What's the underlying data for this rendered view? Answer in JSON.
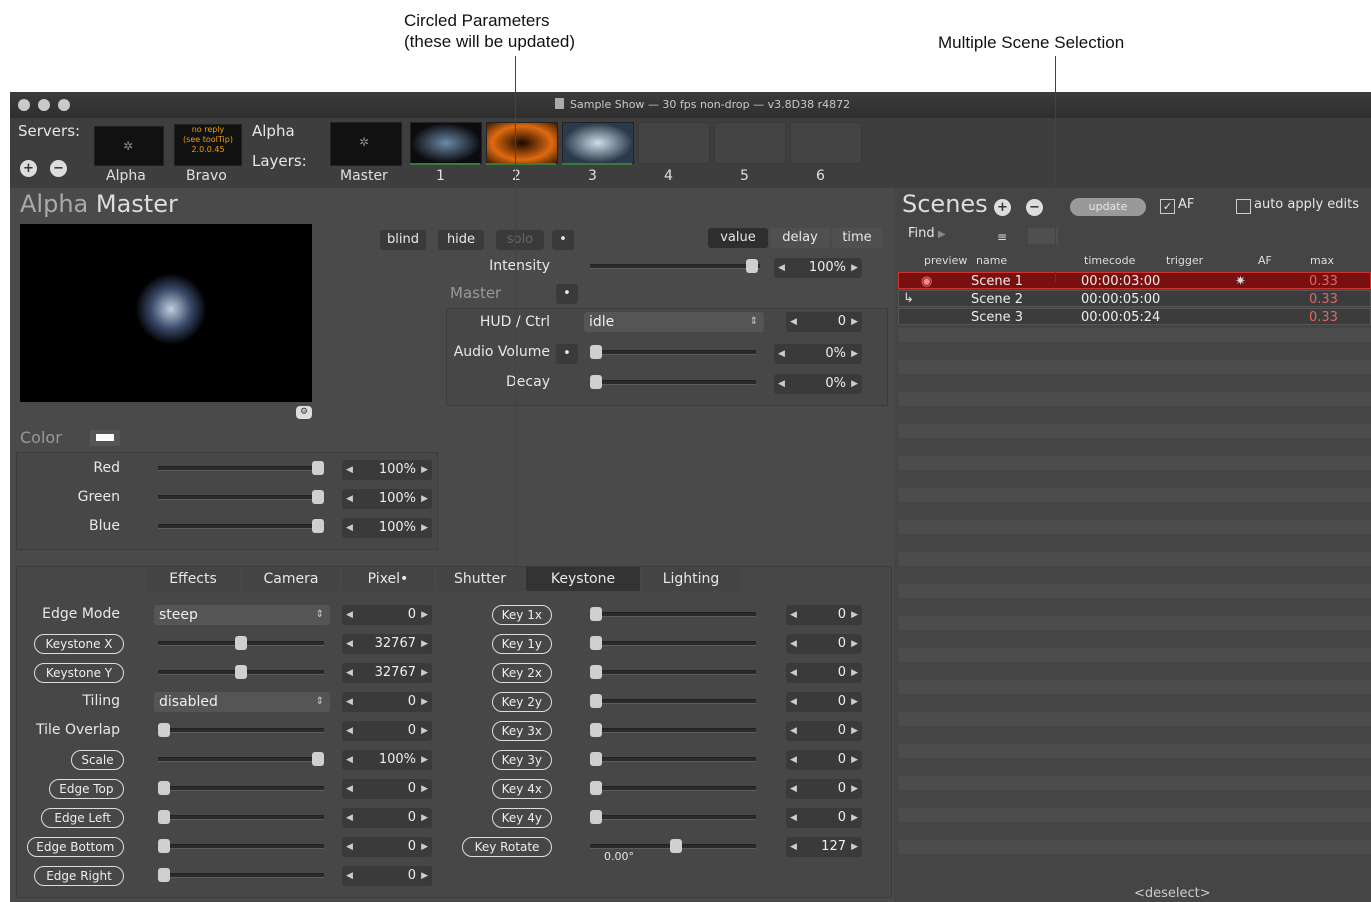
{
  "annotations": {
    "circled_line1": "Circled Parameters",
    "circled_line2": "(these will be updated)",
    "multi_scene": "Multiple Scene Selection"
  },
  "window": {
    "title": "Sample Show  —  30 fps non-drop  —  v3.8D38 r4872"
  },
  "servers": {
    "label": "Servers:",
    "items": [
      "Alpha",
      "Bravo"
    ],
    "bravo_status_line1": "no reply",
    "bravo_status_line2": "(see toolTip)",
    "bravo_status_line3": "2.0.0.45",
    "add_icon": "plus-circle",
    "remove_icon": "minus-circle"
  },
  "layers": {
    "server_name": "Alpha",
    "label": "Layers:",
    "items": [
      "Master",
      "1",
      "2",
      "3",
      "4",
      "5",
      "6"
    ]
  },
  "master": {
    "title_prefix": "Alpha",
    "title_suffix": "Master",
    "buttons": {
      "blind": "blind",
      "hide": "hide",
      "solo": "solo"
    },
    "tabs": [
      "value",
      "delay",
      "time"
    ],
    "intensity_label": "Intensity",
    "intensity_value": "100%",
    "master_label": "Master",
    "hud_label": "HUD / Ctrl",
    "hud_value": "idle",
    "hud_num": "0",
    "audio_label": "Audio Volume",
    "audio_value": "0%",
    "decay_label": "Decay",
    "decay_value": "0%",
    "color_label": "Color",
    "red_label": "Red",
    "red_value": "100%",
    "green_label": "Green",
    "green_value": "100%",
    "blue_label": "Blue",
    "blue_value": "100%"
  },
  "param_tabs": [
    "Effects",
    "Camera",
    "Pixel•",
    "Shutter",
    "Keystone",
    "Lighting"
  ],
  "left_params": [
    {
      "label": "Edge Mode",
      "kind": "select",
      "value": "steep",
      "num": "0",
      "circled": false
    },
    {
      "label": "Keystone X",
      "kind": "slider",
      "level": 0.5,
      "num": "32767",
      "circled": true
    },
    {
      "label": "Keystone Y",
      "kind": "slider",
      "level": 0.5,
      "num": "32767",
      "circled": true
    },
    {
      "label": "Tiling",
      "kind": "select",
      "value": "disabled",
      "num": "0",
      "circled": false
    },
    {
      "label": "Tile Overlap",
      "kind": "slider",
      "level": 0,
      "num": "0",
      "circled": false
    },
    {
      "label": "Scale",
      "kind": "slider",
      "level": 1,
      "num": "100%",
      "circled": true
    },
    {
      "label": "Edge Top",
      "kind": "slider",
      "level": 0,
      "num": "0",
      "circled": true
    },
    {
      "label": "Edge Left",
      "kind": "slider",
      "level": 0,
      "num": "0",
      "circled": true
    },
    {
      "label": "Edge Bottom",
      "kind": "slider",
      "level": 0,
      "num": "0",
      "circled": true
    },
    {
      "label": "Edge Right",
      "kind": "slider",
      "level": 0,
      "num": "0",
      "circled": true
    }
  ],
  "right_params": [
    {
      "label": "Key 1x",
      "num": "0"
    },
    {
      "label": "Key 1y",
      "num": "0"
    },
    {
      "label": "Key 2x",
      "num": "0"
    },
    {
      "label": "Key 2y",
      "num": "0"
    },
    {
      "label": "Key 3x",
      "num": "0"
    },
    {
      "label": "Key 3y",
      "num": "0"
    },
    {
      "label": "Key 4x",
      "num": "0"
    },
    {
      "label": "Key 4y",
      "num": "0"
    },
    {
      "label": "Key Rotate",
      "num": "127",
      "extra": "0.00°"
    }
  ],
  "scenes": {
    "title": "Scenes",
    "update_label": "update",
    "af_label": "AF",
    "af_checked": true,
    "auto_apply_label": "auto apply edits",
    "auto_apply_checked": false,
    "find_label": "Find",
    "columns": [
      "preview",
      "name",
      "timecode",
      "trigger",
      "AF",
      "max"
    ],
    "rows": [
      {
        "name": "Scene 1",
        "timecode": "00:00:03:00",
        "max": "0.33",
        "selected": true
      },
      {
        "name": "Scene 2",
        "timecode": "00:00:05:00",
        "max": "0.33",
        "selected": false
      },
      {
        "name": "Scene 3",
        "timecode": "00:00:05:24",
        "max": "0.33",
        "selected": false
      }
    ],
    "deselect_label": "<deselect>"
  },
  "colors": {
    "accent_line": "#b0102a",
    "selected_row": "#7a0f0f",
    "status_orange": "#f0a000"
  }
}
